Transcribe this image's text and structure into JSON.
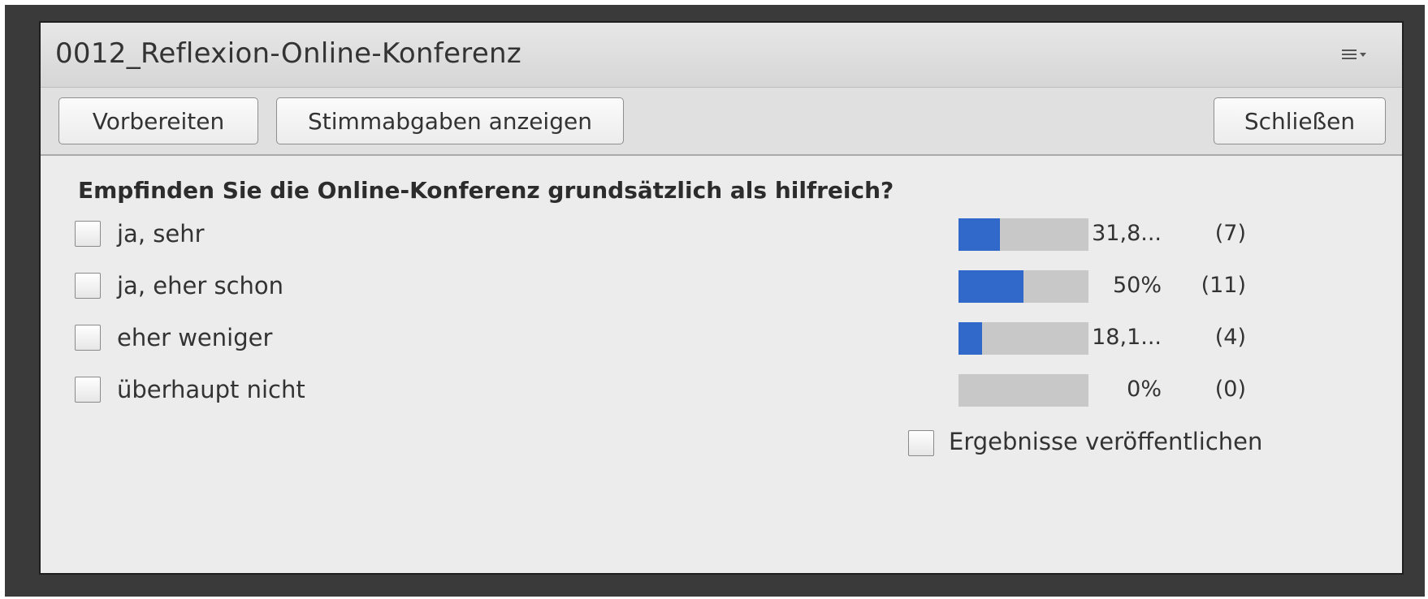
{
  "header": {
    "title": "0012_Reflexion-Online-Konferenz",
    "menu_icon": "hamburger-dropdown-icon"
  },
  "toolbar": {
    "prepare_label": "Vorbereiten",
    "show_votes_label": "Stimmabgaben anzeigen",
    "close_label": "Schließen"
  },
  "poll": {
    "question": "Empfinden Sie die Online-Konferenz grundsätzlich als hilfreich?",
    "options": [
      {
        "label": "ja, sehr",
        "percent_text": "31,8...",
        "count_text": "(7)",
        "fraction": 0.318
      },
      {
        "label": "ja, eher schon",
        "percent_text": "50%",
        "count_text": "(11)",
        "fraction": 0.5
      },
      {
        "label": "eher weniger",
        "percent_text": "18,1...",
        "count_text": "(4)",
        "fraction": 0.181
      },
      {
        "label": "überhaupt nicht",
        "percent_text": "0%",
        "count_text": "(0)",
        "fraction": 0.0
      }
    ],
    "publish_label": "Ergebnisse veröffentlichen"
  },
  "colors": {
    "bar_fill": "#3069c9",
    "bar_track": "#c8c8c8",
    "panel_bg": "#ececec",
    "frame_bg": "#3a3a3a"
  }
}
